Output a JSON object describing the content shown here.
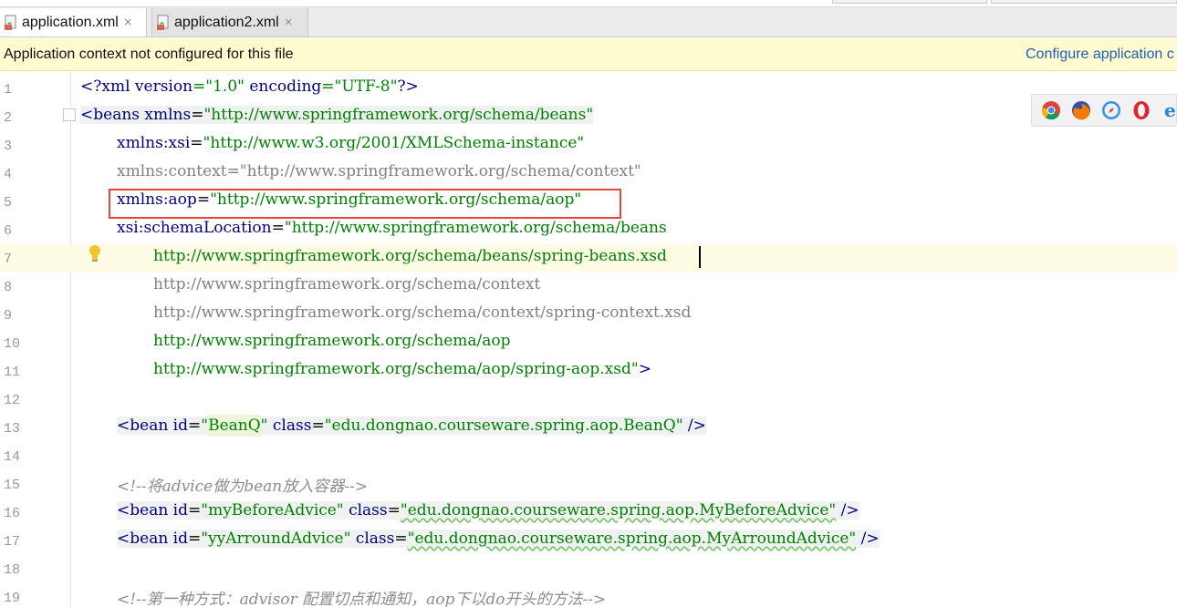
{
  "tabs": [
    {
      "label": "application.xml",
      "close": "×",
      "active": true
    },
    {
      "label": "application2.xml",
      "close": "×",
      "active": false
    }
  ],
  "banner": {
    "message": "Application context not configured for this file",
    "link": "Configure application c"
  },
  "line_numbers": [
    "1",
    "2",
    "3",
    "4",
    "5",
    "6",
    "7",
    "8",
    "9",
    "10",
    "11",
    "12",
    "13",
    "14",
    "15",
    "16",
    "17",
    "18",
    "19"
  ],
  "code": {
    "l1": [
      "<?",
      "xml version",
      "=\"1.0\"",
      " encoding",
      "=\"UTF-8\"",
      "?>"
    ],
    "l2": [
      "<",
      "beans xmlns",
      "=",
      "\"http://www.springframework.org/schema/beans\""
    ],
    "l3": [
      "xmlns:xsi",
      "=",
      "\"http://www.w3.org/2001/XMLSchema-instance\""
    ],
    "l4": "xmlns:context=\"http://www.springframework.org/schema/context\"",
    "l5": [
      "xmlns:aop",
      "=",
      "\"http://www.springframework.org/schema/aop\""
    ],
    "l6": [
      "xsi:schemaLocation",
      "=",
      "\"http://www.springframework.org/schema/beans"
    ],
    "l7": "http://www.springframework.org/schema/beans/spring-beans.xsd",
    "l8": "http://www.springframework.org/schema/context",
    "l9": "http://www.springframework.org/schema/context/spring-context.xsd",
    "l10": "http://www.springframework.org/schema/aop",
    "l11": [
      "http://www.springframework.org/schema/aop/spring-aop.xsd\"",
      ">"
    ],
    "l13": [
      "<",
      "bean id",
      "=",
      "\"",
      "BeanQ",
      "\"",
      " class",
      "=",
      "\"edu.dongnao.courseware.spring.aop.BeanQ\"",
      " />"
    ],
    "l15": "<!--将advice做为bean放入容器-->",
    "l16": [
      "<",
      "bean id",
      "=",
      "\"myBeforeAdvice\"",
      " class",
      "=",
      "\"edu.dongnao.courseware.spring.aop.MyBeforeAdvice\"",
      " />"
    ],
    "l17": [
      "<",
      "bean id",
      "=",
      "\"yyArroundAdvice\"",
      " class",
      "=",
      "\"edu.dongnao.courseware.spring.aop.MyArroundAdvice\"",
      " />"
    ],
    "l19": "<!--第一种方式：advisor 配置切点和通知，aop下以do开头的方法-->"
  },
  "browsers": [
    "chrome-icon",
    "firefox-icon",
    "safari-icon",
    "opera-icon",
    "ie-icon"
  ],
  "colors": {
    "tag": "#000080",
    "value": "#008000",
    "comment": "#8c8c8c",
    "banner_bg": "#fffbd0",
    "highlight_box": "#e3463c"
  }
}
